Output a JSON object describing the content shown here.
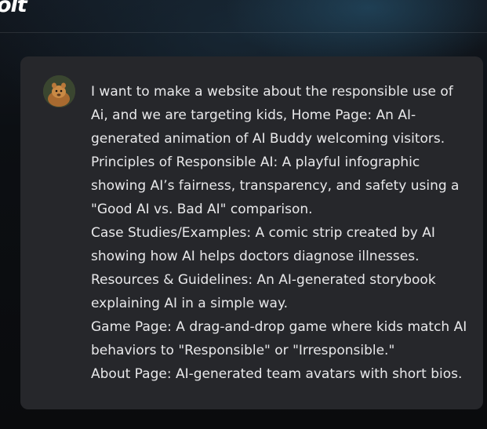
{
  "header": {
    "logo_text": "olt"
  },
  "message": {
    "avatar_icon": "user-avatar-icon",
    "paragraphs": [
      "I want to make a website about the responsible use of Ai, and we are targeting kids, Home Page: An AI-generated animation of AI Buddy welcoming visitors.",
      "Principles of Responsible AI: A playful infographic showing AI’s fairness, transparency, and safety using a \"Good AI vs. Bad AI\" comparison.",
      "Case Studies/Examples: A comic strip created by AI showing how AI helps doctors diagnose illnesses.",
      "Resources & Guidelines: An AI-generated storybook explaining AI in a simple way.",
      "Game Page: A drag-and-drop game where kids match AI behaviors to \"Responsible\" or \"Irresponsible.\"",
      "About Page: AI-generated team avatars with short bios."
    ]
  },
  "colors": {
    "card_background": "#26272b",
    "text": "#e8e8ea",
    "page_background": "#0b0d10"
  }
}
